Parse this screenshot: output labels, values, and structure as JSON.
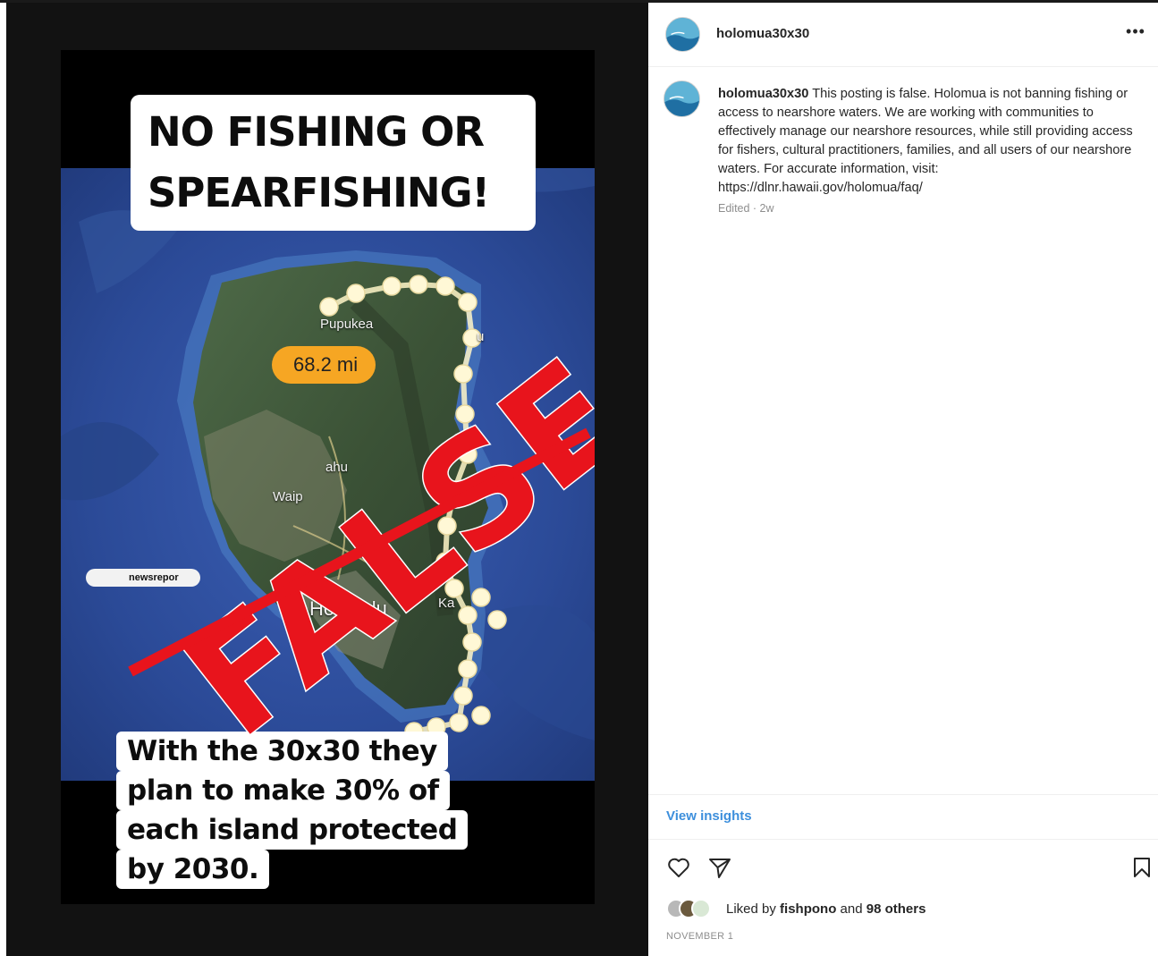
{
  "post": {
    "image": {
      "top_caption_line1": "NO FISHING OR",
      "top_caption_line2": "SPEARFISHING!",
      "stamp_text": "FALSE",
      "distance_label": "68.2 mi",
      "place_honolulu": "Honolulu",
      "place_pupukea": "Pupukea",
      "place_waipahu": "Waip",
      "place_oahu": "ahu",
      "place_kailua": "Ka",
      "place_kahuku": "u",
      "watermark_handle": "newsrepor",
      "bottom_caption_line1": "With the 30x30 they",
      "bottom_caption_line2": "plan to make 30% of",
      "bottom_caption_line3": "each island protected",
      "bottom_caption_line4": "by 2030."
    },
    "header": {
      "username": "holomua30x30",
      "more_icon": "more-horizontal-icon"
    },
    "comment": {
      "username": "holomua30x30",
      "text": "This posting is false. Holomua is not banning fishing or access to nearshore waters. We are working with communities to effectively manage our nearshore resources, while still providing access for fishers, cultural practitioners, families, and all users of our nearshore waters. For accurate information, visit: https://dlnr.hawaii.gov/holomua/faq/",
      "meta": "Edited · 2w"
    },
    "view_insights": "View insights",
    "actions": {
      "like_icon": "heart-icon",
      "share_icon": "send-icon",
      "save_icon": "bookmark-icon"
    },
    "likes": {
      "prefix": "Liked by",
      "first_user": "fishpono",
      "and": "and",
      "others": "98 others"
    },
    "date": "NOVEMBER 1"
  },
  "colors": {
    "stamp_red": "#e8141c",
    "link_blue": "#3d8fdc",
    "ocean": "#2f4fa0",
    "badge_orange": "#f6a623"
  }
}
